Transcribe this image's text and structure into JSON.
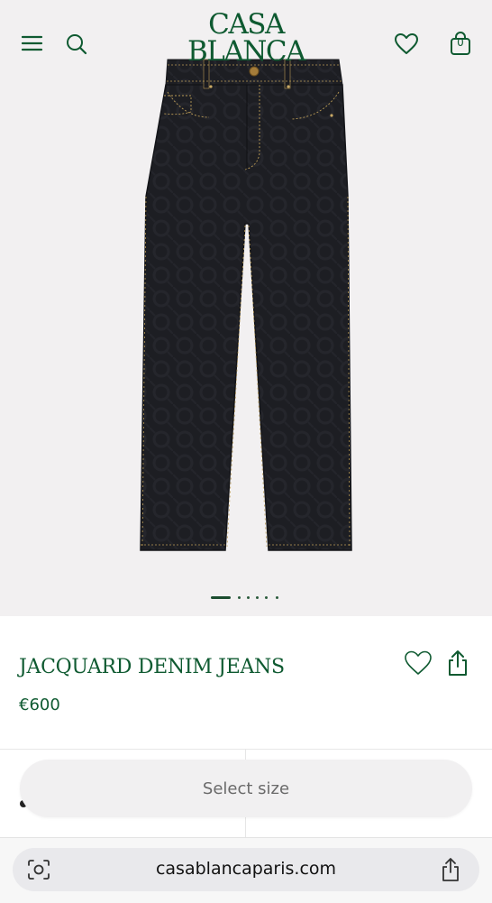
{
  "header": {
    "logo_line1": "CASA",
    "logo_line2": "BLANCA",
    "cart_count": "0",
    "icons": [
      "menu-icon",
      "search-icon",
      "heart-icon",
      "bag-icon"
    ]
  },
  "gallery": {
    "image": "jacquard-denim-jeans-photo",
    "slide_count": 6,
    "active_slide": 1
  },
  "product": {
    "name": "JACQUARD DENIM JEANS",
    "price": "€600"
  },
  "purchase": {
    "select_size_label": "Select size"
  },
  "browser": {
    "url": "casablancaparis.com"
  },
  "colors": {
    "brand_green": "#0f5a31",
    "hero_background": "#f2f0f1",
    "denim": "#1c1d22",
    "stitching": "#b99a55"
  }
}
